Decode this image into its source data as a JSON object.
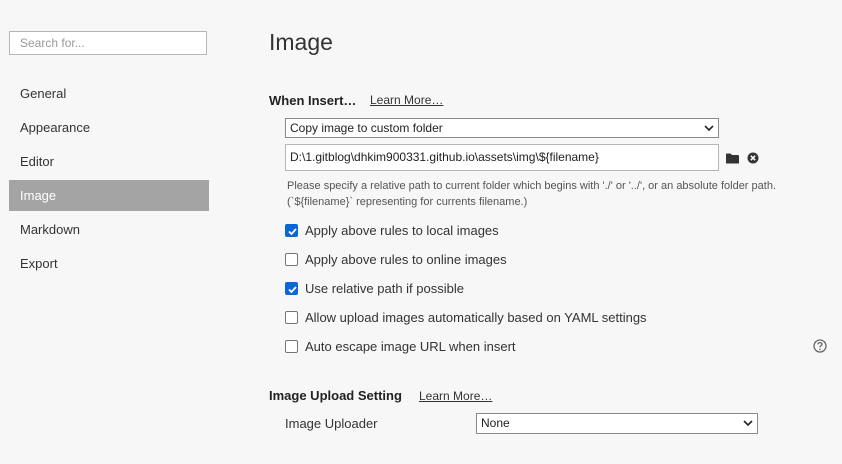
{
  "sidebar": {
    "search_placeholder": "Search for...",
    "items": [
      {
        "label": "General"
      },
      {
        "label": "Appearance"
      },
      {
        "label": "Editor"
      },
      {
        "label": "Image",
        "active": true
      },
      {
        "label": "Markdown"
      },
      {
        "label": "Export"
      }
    ]
  },
  "main": {
    "title": "Image",
    "when_insert": {
      "heading": "When Insert…",
      "learn_more": "Learn More…",
      "action_select": "Copy image to custom folder",
      "folder_path": "D:\\1.gitblog\\dhkim900331.github.io\\assets\\img\\${filename}",
      "folder_icon": "folder-icon",
      "clear_icon": "clear-icon",
      "hint": "Please specify a relative path to current folder which begins with './' or '../', or an absolute folder path. (`${filename}` representing for currents filename.)"
    },
    "options": [
      {
        "label": "Apply above rules to local images",
        "checked": true
      },
      {
        "label": "Apply above rules to online images",
        "checked": false
      },
      {
        "label": "Use relative path if possible",
        "checked": true
      },
      {
        "label": "Allow upload images automatically based on YAML settings",
        "checked": false
      },
      {
        "label": "Auto escape image URL when insert",
        "checked": false
      }
    ],
    "help_icon": "help-icon",
    "upload": {
      "heading": "Image Upload Setting",
      "learn_more": "Learn More…",
      "uploader_label": "Image Uploader",
      "uploader_value": "None"
    }
  },
  "colors": {
    "active_nav_bg": "#a4a4a4",
    "checkbox_checked": "#0a68d6",
    "background": "#f7f7f7"
  }
}
